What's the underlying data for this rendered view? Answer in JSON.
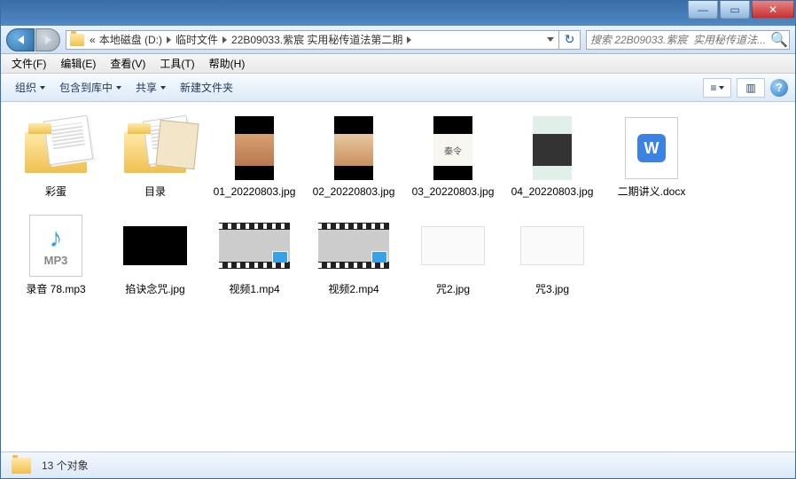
{
  "breadcrumbs": {
    "prefix": "«",
    "parts": [
      "本地磁盘 (D:)",
      "临时文件",
      "22B09033.紫宸  实用秘传道法第二期"
    ]
  },
  "search": {
    "placeholder": "搜索 22B09033.紫宸  实用秘传道法..."
  },
  "menu": {
    "file": "文件(F)",
    "edit": "编辑(E)",
    "view": "查看(V)",
    "tools": "工具(T)",
    "help": "帮助(H)"
  },
  "toolbar": {
    "organize": "组织",
    "include": "包含到库中",
    "share": "共享",
    "newfolder": "新建文件夹"
  },
  "items": [
    {
      "name": "彩蛋",
      "type": "folder"
    },
    {
      "name": "目录",
      "type": "folder"
    },
    {
      "name": "01_20220803.jpg",
      "type": "img",
      "variant": "hand"
    },
    {
      "name": "02_20220803.jpg",
      "type": "img",
      "variant": "hand2"
    },
    {
      "name": "03_20220803.jpg",
      "type": "img",
      "variant": "call"
    },
    {
      "name": "04_20220803.jpg",
      "type": "img",
      "variant": "grn"
    },
    {
      "name": "二期讲义.docx",
      "type": "docx"
    },
    {
      "name": "录音 78.mp3",
      "type": "mp3"
    },
    {
      "name": "掐诀念咒.jpg",
      "type": "smjpg",
      "variant": "black"
    },
    {
      "name": "视频1.mp4",
      "type": "video"
    },
    {
      "name": "视频2.mp4",
      "type": "video"
    },
    {
      "name": "咒2.jpg",
      "type": "smjpg",
      "variant": "white"
    },
    {
      "name": "咒3.jpg",
      "type": "smjpg",
      "variant": "white"
    }
  ],
  "status": {
    "count": "13 个对象"
  },
  "docx_letter": "W",
  "mp3_ext": "MP3"
}
